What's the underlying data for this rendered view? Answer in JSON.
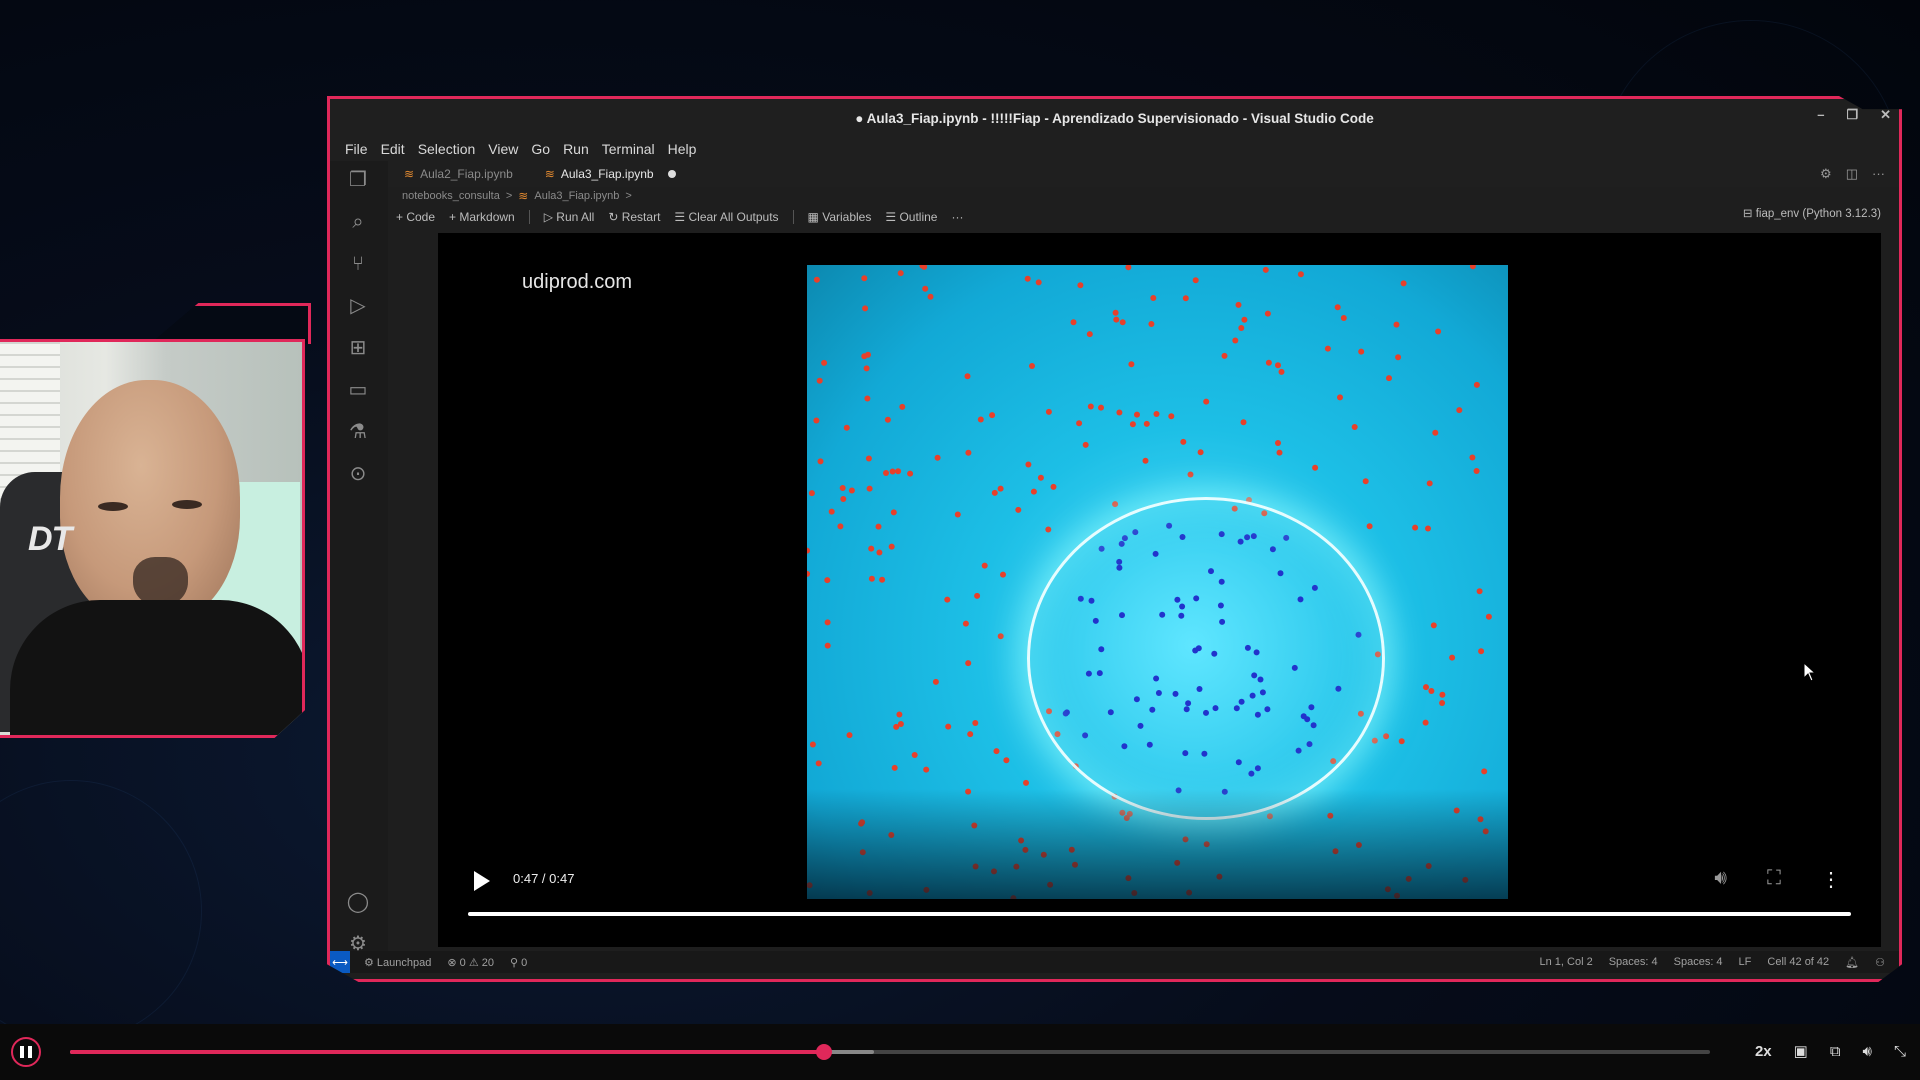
{
  "vscode": {
    "title": "● Aula3_Fiap.ipynb - !!!!!Fiap - Aprendizado Supervisionado - Visual Studio Code",
    "menu": [
      "File",
      "Edit",
      "Selection",
      "View",
      "Go",
      "Run",
      "Terminal",
      "Help"
    ],
    "tabs": [
      {
        "label": "Aula2_Fiap.ipynb",
        "active": false
      },
      {
        "label": "Aula3_Fiap.ipynb",
        "active": true,
        "modified": true
      }
    ],
    "breadcrumb": [
      "notebooks_consulta",
      ">",
      "Aula3_Fiap.ipynb",
      ">"
    ],
    "toolbar": {
      "code": "+ Code",
      "markdown": "+ Markdown",
      "run_all": "Run All",
      "restart": "Restart",
      "clear": "Clear All Outputs",
      "variables": "Variables",
      "outline": "Outline",
      "more": "···",
      "kernel": "fiap_env (Python 3.12.3)"
    },
    "output": {
      "watermark": "udiprod.com",
      "video_time": "0:47 / 0:47",
      "video_progress": 1.0
    },
    "statusbar": {
      "launchpad": "Launchpad",
      "problems": "⊗ 0 ⚠ 20",
      "ports": "⚲ 0",
      "position": "Ln 1, Col 2",
      "spaces1": "Spaces: 4",
      "spaces2": "Spaces: 4",
      "eol": "LF",
      "cell": "Cell 42 of 42"
    }
  },
  "webcam": {
    "chair_logo": "DT"
  },
  "player": {
    "progress": 0.46,
    "buffered": 0.49,
    "speed": "2x"
  },
  "colors": {
    "accent": "#e0285a",
    "vscode_bg": "#1e1e1e",
    "video_cyan": "#1dbfe6",
    "red_dot": "#e8402a",
    "blue_dot": "#2233cc"
  }
}
